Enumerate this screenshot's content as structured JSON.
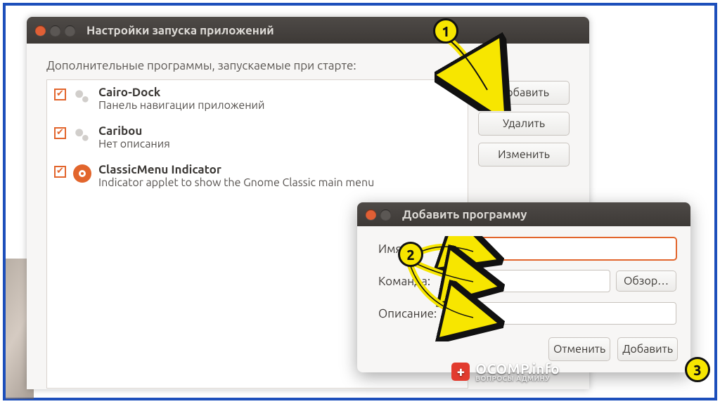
{
  "window_main": {
    "title": "Настройки запуска приложений",
    "subheading": "Дополнительные программы, запускаемые при старте:",
    "items": [
      {
        "title": "Cairo-Dock",
        "desc": "Панель навигации приложений",
        "checked": true,
        "icon": "gears"
      },
      {
        "title": "Caribou",
        "desc": "Нет описания",
        "checked": true,
        "icon": "gears"
      },
      {
        "title": "ClassicMenu Indicator",
        "desc": "Indicator applet to show the Gnome Classic main menu",
        "checked": true,
        "icon": "ubuntu"
      }
    ],
    "buttons": {
      "add": "Добавить",
      "remove": "Удалить",
      "edit": "Изменить"
    }
  },
  "dialog_add": {
    "title": "Добавить программу",
    "fields": {
      "name_label": "Имя:",
      "command_label": "Команда:",
      "desc_label": "Описание:",
      "browse": "Обзор…"
    },
    "values": {
      "name": "",
      "command": "",
      "desc": ""
    },
    "buttons": {
      "cancel": "Отменить",
      "add": "Добавить"
    }
  },
  "annotations": {
    "b1": "1",
    "b2": "2",
    "b3": "3"
  },
  "watermark": {
    "site": "OCOMP.info",
    "tagline": "ВОПРОСЫ АДМИНУ"
  }
}
